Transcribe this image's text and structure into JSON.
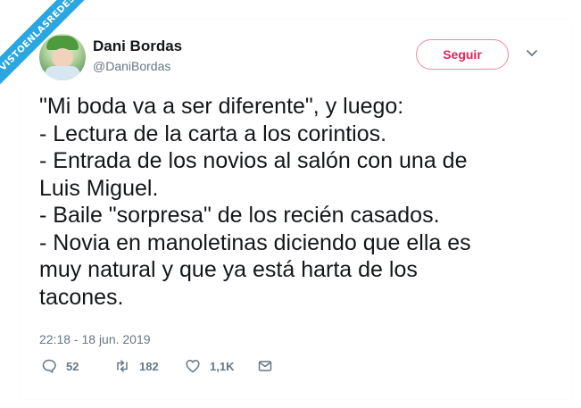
{
  "watermark": {
    "text": "VISTOENLASREDES"
  },
  "user": {
    "name": "Dani Bordas",
    "handle": "@DaniBordas",
    "follow_label": "Seguir"
  },
  "tweet": {
    "lines": [
      "\"Mi boda va a ser diferente\", y luego:",
      "- Lectura de la carta a los corintios.",
      "- Entrada de los novios al salón con una de",
      "Luis Miguel.",
      "- Baile \"sorpresa\" de los recién casados.",
      "- Novia en manoletinas diciendo que ella es",
      "muy natural y que ya está harta de los",
      "tacones."
    ],
    "timestamp": "22:18 - 18 jun. 2019"
  },
  "stats": {
    "replies": "52",
    "retweets": "182",
    "likes": "1,1K"
  },
  "colors": {
    "follow": "#e0245e",
    "muted": "#657786",
    "text": "#14171a",
    "watermark": "#2aa6e0"
  },
  "icons": {
    "reply": "comment-icon",
    "retweet": "retweet-icon",
    "like": "heart-icon",
    "dm": "envelope-icon",
    "more": "chevron-down-icon"
  }
}
